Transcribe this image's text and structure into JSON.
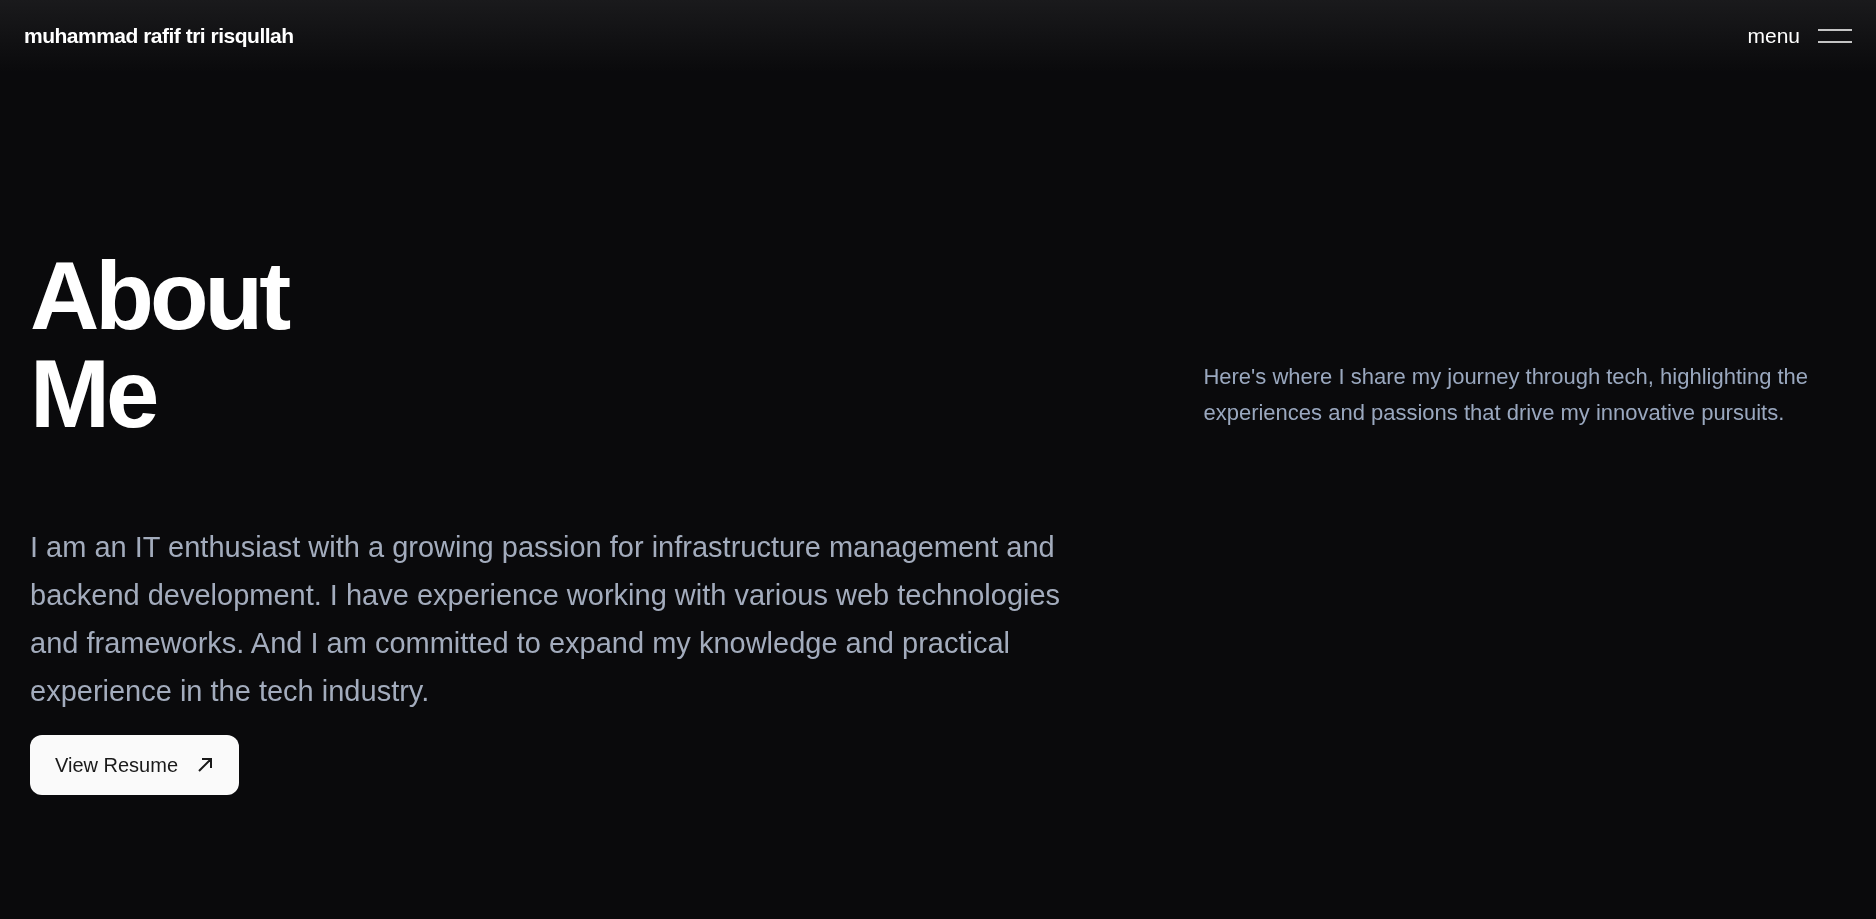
{
  "header": {
    "name": "muhammad rafif tri risqullah",
    "menu": "menu"
  },
  "heading": [
    "About",
    "Me"
  ],
  "intro": "Here's where I share my journey through tech, highlighting the experiences and passions that drive my innovative pursuits.",
  "bio": "I am an IT enthusiast with a growing passion for infrastructure management and backend development. I have experience working with various web technologies and frameworks. And I am committed to expand my knowledge and practical experience in the tech industry.",
  "button": "View Resume"
}
